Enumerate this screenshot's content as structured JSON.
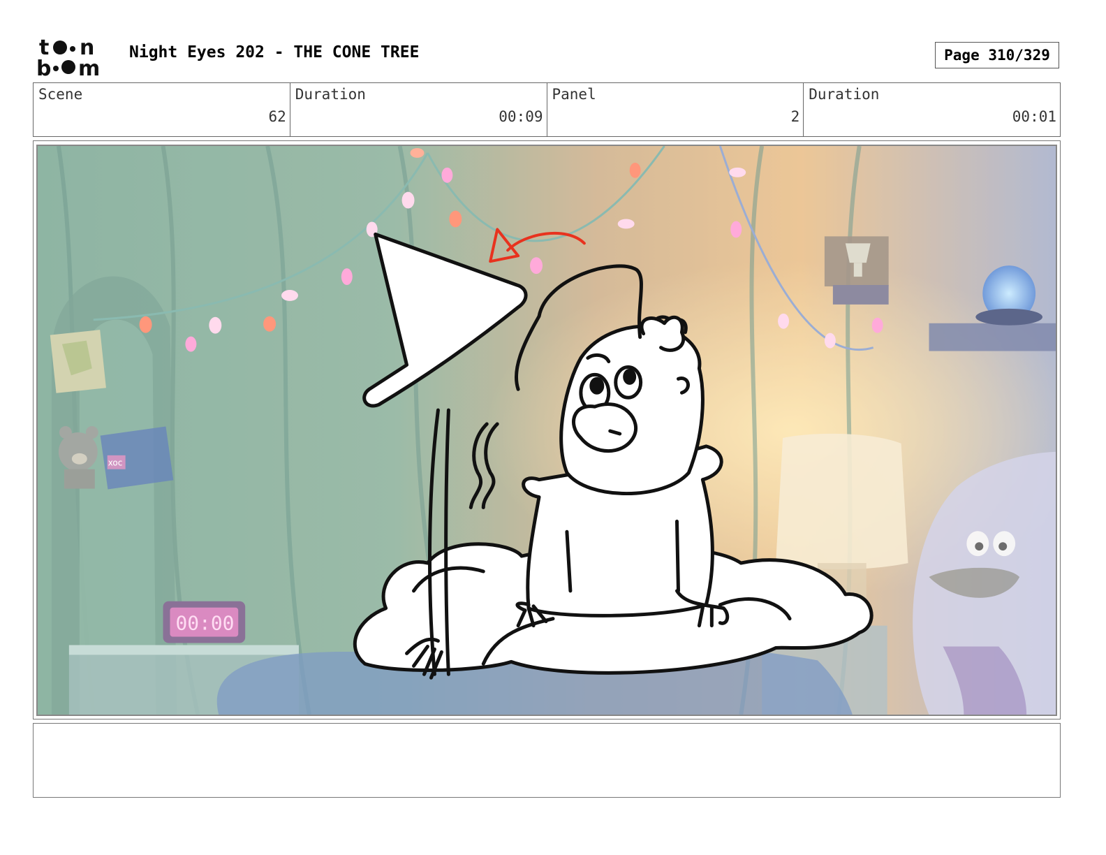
{
  "header": {
    "logo_label": "toon boom",
    "title": "Night Eyes 202 - THE CONE TREE",
    "page": "Page 310/329"
  },
  "info": {
    "scene_label": "Scene",
    "scene_value": "62",
    "scene_duration_label": "Duration",
    "scene_duration_value": "00:09",
    "panel_label": "Panel",
    "panel_value": "2",
    "panel_duration_label": "Duration",
    "panel_duration_value": "00:01"
  },
  "artwork": {
    "clock_display": "00:00",
    "note_scribble": "xoc"
  },
  "notes": {
    "text": ""
  },
  "colors": {
    "arrow_red": "#e8321e",
    "sketch_line": "#111111"
  }
}
